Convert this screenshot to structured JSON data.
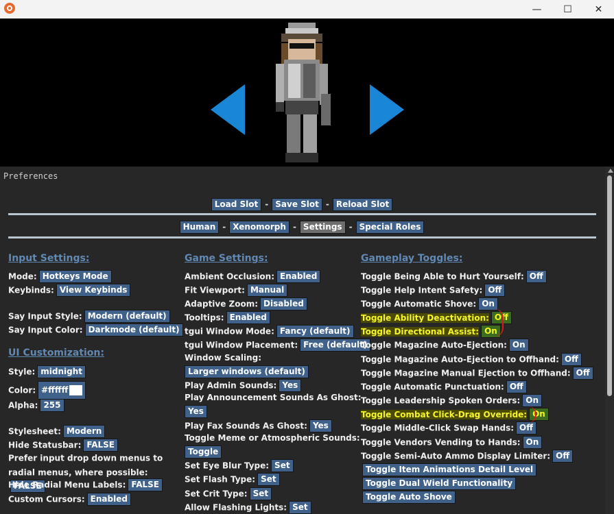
{
  "window": {
    "minimize": "—",
    "maximize": "☐",
    "close": "✕"
  },
  "prefs_title": "Preferences",
  "slots": [
    "Load Slot",
    "Save Slot",
    "Reload Slot"
  ],
  "tabs": [
    "Human",
    "Xenomorph",
    "Settings",
    "Special Roles"
  ],
  "active_tab": "Settings",
  "separator": "-",
  "input_settings": {
    "title": "Input Settings:",
    "mode_label": "Mode:",
    "mode_value": "Hotkeys Mode",
    "keybinds_label": "Keybinds:",
    "keybinds_value": "View Keybinds",
    "say_style_label": "Say Input Style:",
    "say_style_value": "Modern (default)",
    "say_color_label": "Say Input Color:",
    "say_color_value": "Darkmode (default)"
  },
  "ui_customization": {
    "title": "UI Customization:",
    "style_label": "Style:",
    "style_value": "midnight",
    "color_label": "Color:",
    "color_value": "#ffffff",
    "color_swatch": "#ffffff",
    "alpha_label": "Alpha:",
    "alpha_value": "255",
    "stylesheet_label": "Stylesheet:",
    "stylesheet_value": "Modern",
    "hide_statusbar_label": "Hide Statusbar:",
    "hide_statusbar_value": "FALSE",
    "prefer_dropdown_label": "Prefer input drop down menus to radial menus, where possible:",
    "prefer_dropdown_value": "FALSE",
    "hide_radial_label": "Hide Radial Menu Labels:",
    "hide_radial_value": "FALSE",
    "cursors_label": "Custom Cursors:",
    "cursors_value": "Enabled"
  },
  "game_settings": {
    "title": "Game Settings:",
    "ambient_label": "Ambient Occlusion:",
    "ambient_value": "Enabled",
    "fit_label": "Fit Viewport:",
    "fit_value": "Manual",
    "zoom_label": "Adaptive Zoom:",
    "zoom_value": "Disabled",
    "tooltips_label": "Tooltips:",
    "tooltips_value": "Enabled",
    "tgui_mode_label": "tgui Window Mode:",
    "tgui_mode_value": "Fancy (default)",
    "tgui_place_label": "tgui Window Placement:",
    "tgui_place_value": "Free (default)",
    "scaling_label": "Window Scaling:",
    "scaling_value": "Larger windows (default)",
    "admin_sounds_label": "Play Admin Sounds:",
    "admin_sounds_value": "Yes",
    "announce_label": "Play Announcement Sounds As Ghost:",
    "announce_value": "Yes",
    "fax_label": "Play Fax Sounds As Ghost:",
    "fax_value": "Yes",
    "meme_label": "Toggle Meme or Atmospheric Sounds:",
    "meme_value": "Toggle",
    "eye_label": "Set Eye Blur Type:",
    "eye_value": "Set",
    "flash_label": "Set Flash Type:",
    "flash_value": "Set",
    "crit_label": "Set Crit Type:",
    "crit_value": "Set",
    "flashing_label": "Allow Flashing Lights:",
    "flashing_value": "Set"
  },
  "gameplay_toggles": {
    "title": "Gameplay Toggles:",
    "items": [
      {
        "label": "Toggle Being Able to Hurt Yourself:",
        "value": "Off"
      },
      {
        "label": "Toggle Help Intent Safety:",
        "value": "Off"
      },
      {
        "label": "Toggle Automatic Shove:",
        "value": "On"
      },
      {
        "label": "Toggle Ability Deactivation:",
        "value": "Off"
      },
      {
        "label": "Toggle Directional Assist:",
        "value": "On"
      },
      {
        "label": "Toggle Magazine Auto-Ejection:",
        "value": "On"
      },
      {
        "label": "Toggle Magazine Auto-Ejection to Offhand:",
        "value": "Off"
      },
      {
        "label": "Toggle Magazine Manual Ejection to Offhand:",
        "value": "Off"
      },
      {
        "label": "Toggle Automatic Punctuation:",
        "value": "Off"
      },
      {
        "label": "Toggle Leadership Spoken Orders:",
        "value": "On"
      },
      {
        "label": "Toggle Combat Click-Drag Override:",
        "value": "On"
      },
      {
        "label": "Toggle Middle-Click Swap Hands:",
        "value": "Off"
      },
      {
        "label": "Toggle Vendors Vending to Hands:",
        "value": "On"
      },
      {
        "label": "Toggle Semi-Auto Ammo Display Limiter:",
        "value": "Off"
      }
    ],
    "buttons": [
      "Toggle Item Animations Detail Level",
      "Toggle Dual Wield Functionality",
      "Toggle Auto Shove"
    ]
  },
  "colors": {
    "button": "#40628a",
    "highlight_text": "#f5f52a",
    "section_title": "#6189b3",
    "arrow": "#1a86d6",
    "annotation": "#e01818"
  },
  "icons": {
    "app": "app-logo-icon",
    "left": "arrow-left-icon",
    "right": "arrow-right-icon"
  }
}
